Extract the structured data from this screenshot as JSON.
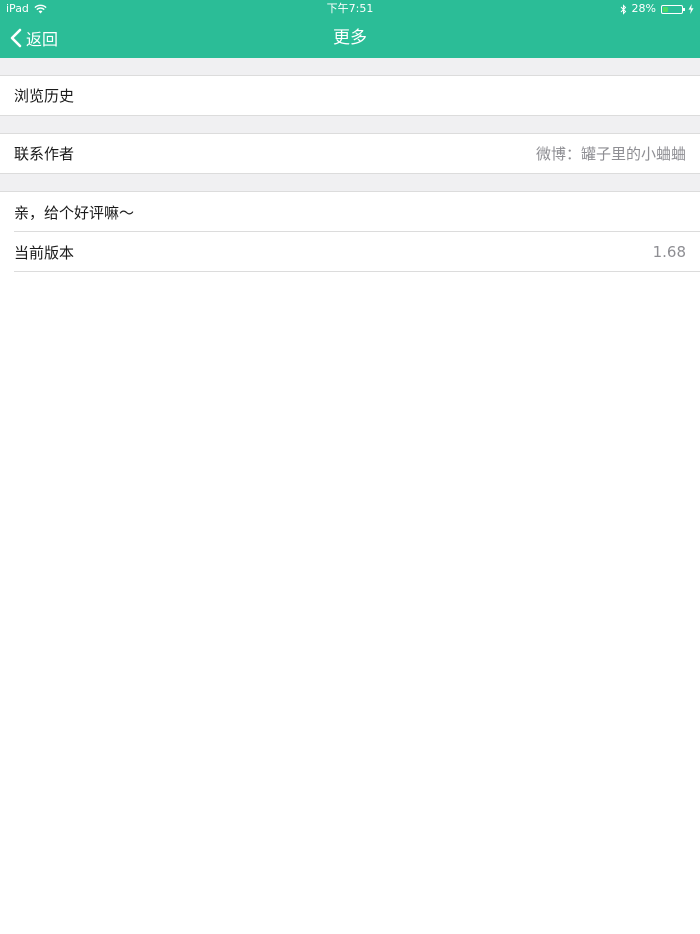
{
  "status_bar": {
    "device": "iPad",
    "time": "下午7:51",
    "battery": "28%",
    "battery_level": 0.28,
    "icons": [
      "wifi-icon",
      "bluetooth-icon",
      "battery-icon"
    ]
  },
  "nav": {
    "back_label": "返回",
    "title": "更多",
    "back_icon": "chevron-left-icon"
  },
  "colors": {
    "header": "#2bbd97",
    "detail_text": "#8e8e93",
    "battery_fill": "#4cd964"
  },
  "list": {
    "history_label": "浏览历史",
    "contact_label": "联系作者",
    "contact_detail": "微博：罐子里的小蛐蛐",
    "review_label": "亲，给个好评嘛～",
    "version_label": "当前版本",
    "version_value": "1.68"
  }
}
